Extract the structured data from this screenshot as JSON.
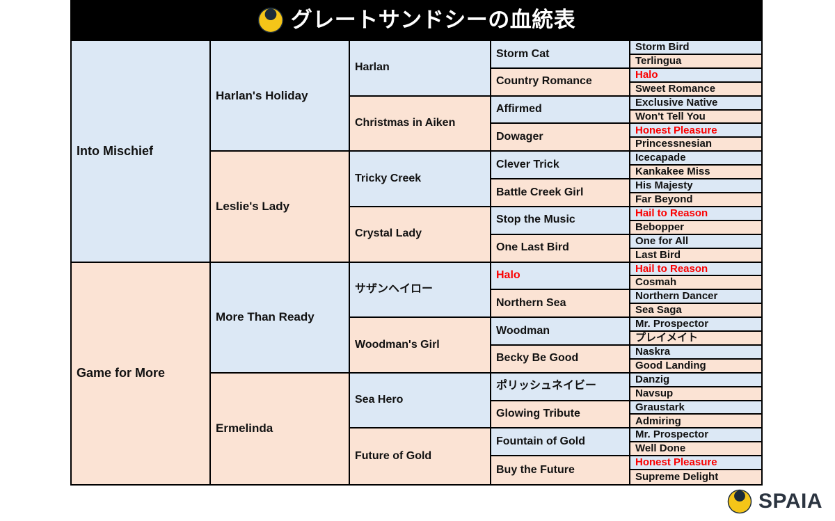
{
  "header": {
    "title": "グレートサンドシーの血統表",
    "logo_icon": "spaia-swirl-logo-icon",
    "background_color": "#000000",
    "text_color": "#ffffff"
  },
  "brand": {
    "name": "SPAIA",
    "logo_icon": "spaia-swirl-logo-icon",
    "text_color": "#2b3440"
  },
  "colors": {
    "sire_cell": "#dce8f5",
    "dam_cell": "#fbe3d4",
    "highlight_text": "#fb0000",
    "text": "#111111",
    "border": "#000000",
    "logo_gold": "#f5c518",
    "logo_navy": "#1b2b3a"
  },
  "pedigree": {
    "generation_1": [
      {
        "name": "Into Mischief",
        "line": "sire",
        "highlight": false
      },
      {
        "name": "Game for More",
        "line": "dam",
        "highlight": false
      }
    ],
    "generation_2": [
      {
        "name": "Harlan's Holiday",
        "line": "sire",
        "highlight": false
      },
      {
        "name": "Leslie's Lady",
        "line": "dam",
        "highlight": false
      },
      {
        "name": "More Than Ready",
        "line": "sire",
        "highlight": false
      },
      {
        "name": "Ermelinda",
        "line": "dam",
        "highlight": false
      }
    ],
    "generation_3": [
      {
        "name": "Harlan",
        "line": "sire",
        "highlight": false
      },
      {
        "name": "Christmas in Aiken",
        "line": "dam",
        "highlight": false
      },
      {
        "name": "Tricky Creek",
        "line": "sire",
        "highlight": false
      },
      {
        "name": "Crystal Lady",
        "line": "dam",
        "highlight": false
      },
      {
        "name": "サザンヘイロー",
        "line": "sire",
        "highlight": false
      },
      {
        "name": "Woodman's Girl",
        "line": "dam",
        "highlight": false
      },
      {
        "name": "Sea Hero",
        "line": "sire",
        "highlight": false
      },
      {
        "name": "Future of Gold",
        "line": "dam",
        "highlight": false
      }
    ],
    "generation_4": [
      {
        "name": "Storm Cat",
        "line": "sire",
        "highlight": false
      },
      {
        "name": "Country Romance",
        "line": "dam",
        "highlight": false
      },
      {
        "name": "Affirmed",
        "line": "sire",
        "highlight": false
      },
      {
        "name": "Dowager",
        "line": "dam",
        "highlight": false
      },
      {
        "name": "Clever Trick",
        "line": "sire",
        "highlight": false
      },
      {
        "name": "Battle Creek Girl",
        "line": "dam",
        "highlight": false
      },
      {
        "name": "Stop the Music",
        "line": "sire",
        "highlight": false
      },
      {
        "name": "One Last Bird",
        "line": "dam",
        "highlight": false
      },
      {
        "name": "Halo",
        "line": "sire",
        "highlight": true
      },
      {
        "name": "Northern Sea",
        "line": "dam",
        "highlight": false
      },
      {
        "name": "Woodman",
        "line": "sire",
        "highlight": false
      },
      {
        "name": "Becky Be Good",
        "line": "dam",
        "highlight": false
      },
      {
        "name": "ポリッシュネイビー",
        "line": "sire",
        "highlight": false
      },
      {
        "name": "Glowing Tribute",
        "line": "dam",
        "highlight": false
      },
      {
        "name": "Fountain of Gold",
        "line": "sire",
        "highlight": false
      },
      {
        "name": "Buy the Future",
        "line": "dam",
        "highlight": false
      }
    ],
    "generation_5": [
      {
        "name": "Storm Bird",
        "line": "sire",
        "highlight": false
      },
      {
        "name": "Terlingua",
        "line": "dam",
        "highlight": false
      },
      {
        "name": "Halo",
        "line": "sire",
        "highlight": true
      },
      {
        "name": "Sweet Romance",
        "line": "dam",
        "highlight": false
      },
      {
        "name": "Exclusive Native",
        "line": "sire",
        "highlight": false
      },
      {
        "name": "Won't Tell You",
        "line": "dam",
        "highlight": false
      },
      {
        "name": "Honest Pleasure",
        "line": "sire",
        "highlight": true
      },
      {
        "name": "Princessnesian",
        "line": "dam",
        "highlight": false
      },
      {
        "name": "Icecapade",
        "line": "sire",
        "highlight": false
      },
      {
        "name": "Kankakee Miss",
        "line": "dam",
        "highlight": false
      },
      {
        "name": "His Majesty",
        "line": "sire",
        "highlight": false
      },
      {
        "name": "Far Beyond",
        "line": "dam",
        "highlight": false
      },
      {
        "name": "Hail to Reason",
        "line": "sire",
        "highlight": true
      },
      {
        "name": "Bebopper",
        "line": "dam",
        "highlight": false
      },
      {
        "name": "One for All",
        "line": "sire",
        "highlight": false
      },
      {
        "name": "Last Bird",
        "line": "dam",
        "highlight": false
      },
      {
        "name": "Hail to Reason",
        "line": "sire",
        "highlight": true
      },
      {
        "name": "Cosmah",
        "line": "dam",
        "highlight": false
      },
      {
        "name": "Northern Dancer",
        "line": "sire",
        "highlight": false
      },
      {
        "name": "Sea Saga",
        "line": "dam",
        "highlight": false
      },
      {
        "name": "Mr. Prospector",
        "line": "sire",
        "highlight": false
      },
      {
        "name": "プレイメイト",
        "line": "dam",
        "highlight": false
      },
      {
        "name": "Naskra",
        "line": "sire",
        "highlight": false
      },
      {
        "name": "Good Landing",
        "line": "dam",
        "highlight": false
      },
      {
        "name": "Danzig",
        "line": "sire",
        "highlight": false
      },
      {
        "name": "Navsup",
        "line": "dam",
        "highlight": false
      },
      {
        "name": "Graustark",
        "line": "sire",
        "highlight": false
      },
      {
        "name": "Admiring",
        "line": "dam",
        "highlight": false
      },
      {
        "name": "Mr. Prospector",
        "line": "sire",
        "highlight": false
      },
      {
        "name": "Well Done",
        "line": "dam",
        "highlight": false
      },
      {
        "name": "Honest Pleasure",
        "line": "sire",
        "highlight": true
      },
      {
        "name": "Supreme Delight",
        "line": "dam",
        "highlight": false
      }
    ]
  }
}
